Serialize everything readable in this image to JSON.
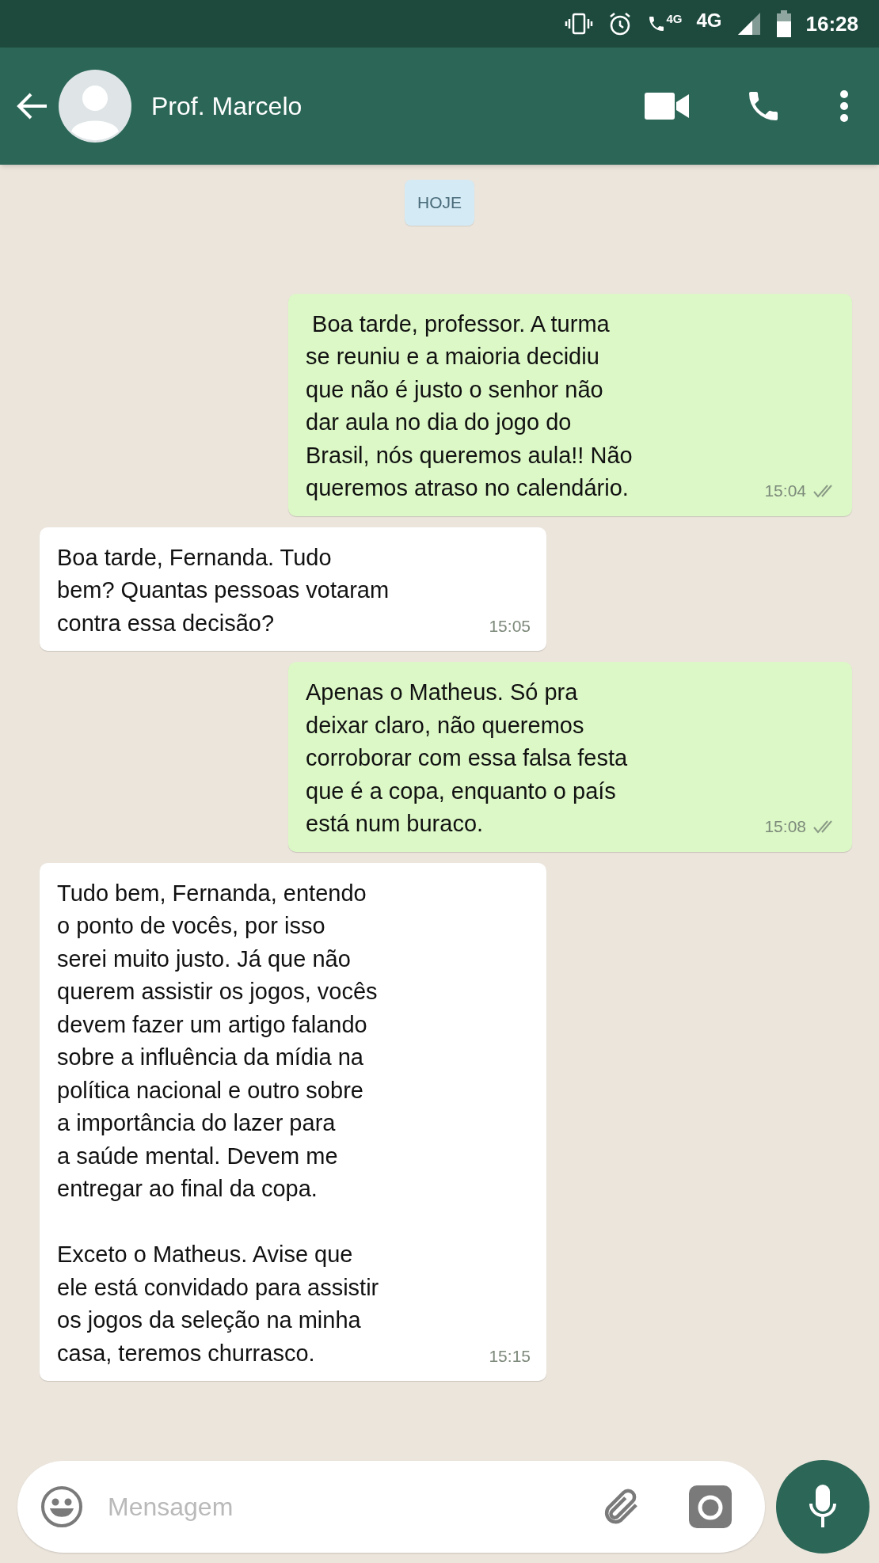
{
  "status_bar": {
    "network_call": "4G",
    "network": "4G",
    "time": "16:28"
  },
  "header": {
    "contact_name": "Prof. Marcelo"
  },
  "date_chip": "HOJE",
  "messages": [
    {
      "kind": "outgoing",
      "text": " Boa tarde, professor. A turma\nse reuniu e a maioria decidiu\nque não é justo o senhor não\ndar aula no dia do jogo do\nBrasil, nós queremos aula!! Não\nqueremos atraso no calendário.",
      "time": "15:04",
      "read": false
    },
    {
      "kind": "incoming",
      "text": "Boa tarde, Fernanda. Tudo\nbem? Quantas pessoas votaram\ncontra essa decisão?",
      "time": "15:05"
    },
    {
      "kind": "outgoing",
      "text": "Apenas o Matheus. Só pra\ndeixar claro, não queremos\ncorroborar com essa falsa festa\nque é a copa, enquanto o país\nestá num buraco.",
      "time": "15:08",
      "read": false
    },
    {
      "kind": "incoming",
      "text": "Tudo bem, Fernanda, entendo\no ponto de vocês, por isso\nserei muito justo. Já que não\nquerem assistir os jogos, vocês\ndevem fazer um artigo falando\nsobre a influência da mídia na\npolítica nacional e outro sobre\na importância do lazer para\na saúde mental. Devem me\nentregar ao final da copa.\n\nExceto o Matheus. Avise que\nele está convidado para assistir\nos jogos da seleção na minha\ncasa, teremos churrasco.",
      "time": "15:15"
    }
  ],
  "composer": {
    "placeholder": "Mensagem"
  }
}
